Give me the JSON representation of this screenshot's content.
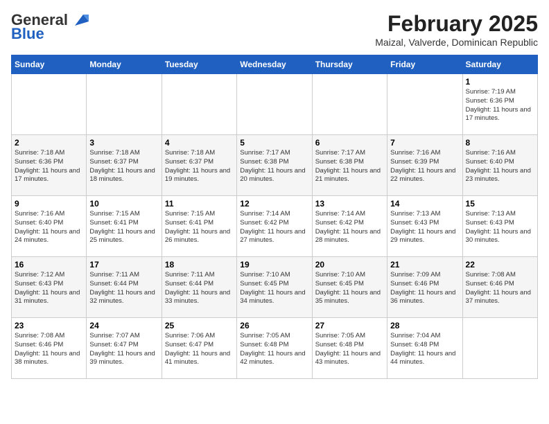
{
  "header": {
    "logo_general": "General",
    "logo_blue": "Blue",
    "month_title": "February 2025",
    "location": "Maizal, Valverde, Dominican Republic"
  },
  "weekdays": [
    "Sunday",
    "Monday",
    "Tuesday",
    "Wednesday",
    "Thursday",
    "Friday",
    "Saturday"
  ],
  "weeks": [
    [
      {
        "day": "",
        "info": ""
      },
      {
        "day": "",
        "info": ""
      },
      {
        "day": "",
        "info": ""
      },
      {
        "day": "",
        "info": ""
      },
      {
        "day": "",
        "info": ""
      },
      {
        "day": "",
        "info": ""
      },
      {
        "day": "1",
        "info": "Sunrise: 7:19 AM\nSunset: 6:36 PM\nDaylight: 11 hours and 17 minutes."
      }
    ],
    [
      {
        "day": "2",
        "info": "Sunrise: 7:18 AM\nSunset: 6:36 PM\nDaylight: 11 hours and 17 minutes."
      },
      {
        "day": "3",
        "info": "Sunrise: 7:18 AM\nSunset: 6:37 PM\nDaylight: 11 hours and 18 minutes."
      },
      {
        "day": "4",
        "info": "Sunrise: 7:18 AM\nSunset: 6:37 PM\nDaylight: 11 hours and 19 minutes."
      },
      {
        "day": "5",
        "info": "Sunrise: 7:17 AM\nSunset: 6:38 PM\nDaylight: 11 hours and 20 minutes."
      },
      {
        "day": "6",
        "info": "Sunrise: 7:17 AM\nSunset: 6:38 PM\nDaylight: 11 hours and 21 minutes."
      },
      {
        "day": "7",
        "info": "Sunrise: 7:16 AM\nSunset: 6:39 PM\nDaylight: 11 hours and 22 minutes."
      },
      {
        "day": "8",
        "info": "Sunrise: 7:16 AM\nSunset: 6:40 PM\nDaylight: 11 hours and 23 minutes."
      }
    ],
    [
      {
        "day": "9",
        "info": "Sunrise: 7:16 AM\nSunset: 6:40 PM\nDaylight: 11 hours and 24 minutes."
      },
      {
        "day": "10",
        "info": "Sunrise: 7:15 AM\nSunset: 6:41 PM\nDaylight: 11 hours and 25 minutes."
      },
      {
        "day": "11",
        "info": "Sunrise: 7:15 AM\nSunset: 6:41 PM\nDaylight: 11 hours and 26 minutes."
      },
      {
        "day": "12",
        "info": "Sunrise: 7:14 AM\nSunset: 6:42 PM\nDaylight: 11 hours and 27 minutes."
      },
      {
        "day": "13",
        "info": "Sunrise: 7:14 AM\nSunset: 6:42 PM\nDaylight: 11 hours and 28 minutes."
      },
      {
        "day": "14",
        "info": "Sunrise: 7:13 AM\nSunset: 6:43 PM\nDaylight: 11 hours and 29 minutes."
      },
      {
        "day": "15",
        "info": "Sunrise: 7:13 AM\nSunset: 6:43 PM\nDaylight: 11 hours and 30 minutes."
      }
    ],
    [
      {
        "day": "16",
        "info": "Sunrise: 7:12 AM\nSunset: 6:43 PM\nDaylight: 11 hours and 31 minutes."
      },
      {
        "day": "17",
        "info": "Sunrise: 7:11 AM\nSunset: 6:44 PM\nDaylight: 11 hours and 32 minutes."
      },
      {
        "day": "18",
        "info": "Sunrise: 7:11 AM\nSunset: 6:44 PM\nDaylight: 11 hours and 33 minutes."
      },
      {
        "day": "19",
        "info": "Sunrise: 7:10 AM\nSunset: 6:45 PM\nDaylight: 11 hours and 34 minutes."
      },
      {
        "day": "20",
        "info": "Sunrise: 7:10 AM\nSunset: 6:45 PM\nDaylight: 11 hours and 35 minutes."
      },
      {
        "day": "21",
        "info": "Sunrise: 7:09 AM\nSunset: 6:46 PM\nDaylight: 11 hours and 36 minutes."
      },
      {
        "day": "22",
        "info": "Sunrise: 7:08 AM\nSunset: 6:46 PM\nDaylight: 11 hours and 37 minutes."
      }
    ],
    [
      {
        "day": "23",
        "info": "Sunrise: 7:08 AM\nSunset: 6:46 PM\nDaylight: 11 hours and 38 minutes."
      },
      {
        "day": "24",
        "info": "Sunrise: 7:07 AM\nSunset: 6:47 PM\nDaylight: 11 hours and 39 minutes."
      },
      {
        "day": "25",
        "info": "Sunrise: 7:06 AM\nSunset: 6:47 PM\nDaylight: 11 hours and 41 minutes."
      },
      {
        "day": "26",
        "info": "Sunrise: 7:05 AM\nSunset: 6:48 PM\nDaylight: 11 hours and 42 minutes."
      },
      {
        "day": "27",
        "info": "Sunrise: 7:05 AM\nSunset: 6:48 PM\nDaylight: 11 hours and 43 minutes."
      },
      {
        "day": "28",
        "info": "Sunrise: 7:04 AM\nSunset: 6:48 PM\nDaylight: 11 hours and 44 minutes."
      },
      {
        "day": "",
        "info": ""
      }
    ]
  ]
}
